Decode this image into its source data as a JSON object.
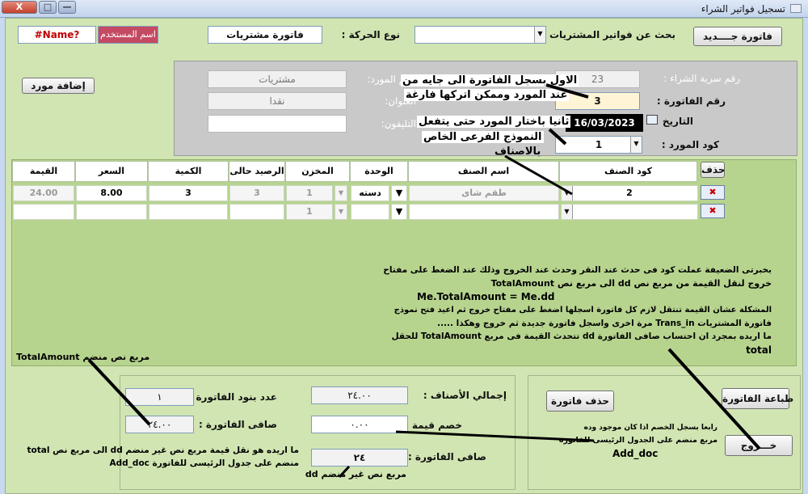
{
  "window": {
    "title": "تسجيل فواتير الشراء",
    "min_symbol": "—",
    "max_symbol": "□",
    "close_symbol": "X"
  },
  "header": {
    "new_invoice": "فاتورة جــــديد",
    "search_label": "بحث عن فواتير المشتريات",
    "search_value": "",
    "movement_label": "نوع الحركة :",
    "movement_value": "فاتورة مشتريات",
    "user_label": "اسم المستخدم",
    "user_value": "#Name?"
  },
  "supplier": {
    "add_supplier": "إضافة مورد",
    "serial_label": "رقم سرية الشراء :",
    "serial_value": "23",
    "invoice_no_label": "رقم الفاتورة :",
    "invoice_no_value": "3",
    "date_label": "التاريخ",
    "date_value": "16/03/2023",
    "code_label": "كود المورد :",
    "code_value": "1",
    "name_label": "اسم المورد:",
    "name_value": "مشتريات",
    "address_label": "العنوان:",
    "address_value": "نقدا",
    "phone_label": "التليفون:",
    "phone_value": ""
  },
  "annotations": {
    "first": "الاول بسجل الفاتورة الى جايه من",
    "first2": "عند المورد وممكن اتركها فارغة",
    "second": "ثانيا باختار المورد حتى يتفعل",
    "second2": "النموذج الفرعى الخاص",
    "second3": "بالاصناف",
    "totalamount": "مربع نص منضم TotalAmount",
    "dd": "مربع نص غير منضم dd",
    "third1": "ما اريده هو نقل قيمة مربع نص غير منضم dd الى مربع نص total",
    "third2": "منضم على جدول الرئيسى للفاتورة Add_doc",
    "fourth1": "رابعا بسجل الخصم اذا كان موجود وده",
    "fourth2": "مربع منضم على الجدول الرئيسى للفاتورة",
    "fourth3": "Add_doc"
  },
  "grid": {
    "delete_label": "حذف",
    "headers": [
      "كود الصنف",
      "اسم الصنف",
      "الوحدة",
      "المخزن",
      "الرصيد حالى",
      "الكمية",
      "السعر",
      "القيمة"
    ],
    "rows": [
      {
        "code": "2",
        "name": "طقم شاى",
        "unit": "دسته",
        "store": "1",
        "balance": "3",
        "qty": "3",
        "price": "8.00",
        "value": "24.00"
      },
      {
        "code": "",
        "name": "",
        "unit": "",
        "store": "1",
        "balance": "",
        "qty": "",
        "price": "",
        "value": ""
      }
    ]
  },
  "notes": [
    "بخبرتى الضعيفة عملت كود فى حدث عند النقر وحدث عند الخروج وذلك عند الضغط على مفتاح",
    "خروج لنقل القيمة من مربع نص dd الى مربع نص TotalAmount",
    "Me.TotalAmount = Me.dd",
    "المشكلة عشان القيمة تنتقل لازم كل فاتورة اسجلها اضغط على مفتاح خروج ثم اعيد فتح نموذج",
    "فاتورة المشتريات Trans_in مرة اخرى واسجل فاتورة جديدة ثم خروج وهكذا .....",
    "ما اريده بمجرد ان احتساب صافى الفاتورة dd تتحدث القيمة فى مربع TotalAmount للحقل",
    "total"
  ],
  "totals": {
    "items_total_label": "إجمالي الأصناف :",
    "items_total_value": "٢٤.٠٠",
    "discount_label": "خصم قيمة :",
    "discount_value": "٠.٠٠",
    "net_label": "صافى الفاتورة :",
    "net_value": "٢٤",
    "lines_count_label": "عدد بنود الفاتورة :",
    "lines_count_value": "١",
    "net_invoice_label": "صافى الفاتورة :",
    "net_invoice_value": "٢٤.٠٠"
  },
  "actions": {
    "print": "طباعة الفاتورة",
    "delete_invoice": "حذف فاتورة",
    "exit": "خـــروج"
  },
  "colors": {
    "form_bg": "#d1e5b2",
    "user_badge": "#c44a63",
    "window_close": "#c3402c"
  }
}
